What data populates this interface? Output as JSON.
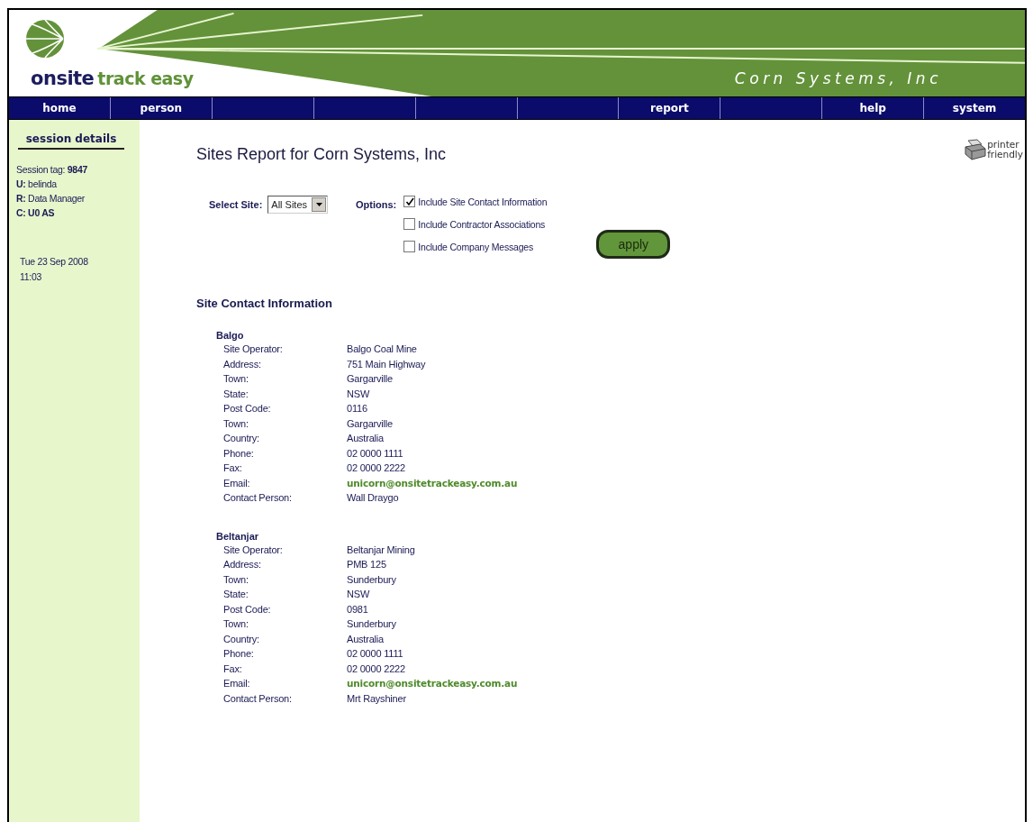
{
  "header": {
    "brand": "onsite",
    "tagline": "track easy",
    "company": "Corn Systems, Inc"
  },
  "nav": [
    {
      "kind": "tab",
      "label": "home"
    },
    {
      "kind": "tab",
      "label": "person"
    },
    {
      "kind": "blank"
    },
    {
      "kind": "blank"
    },
    {
      "kind": "blank"
    },
    {
      "kind": "blank"
    },
    {
      "kind": "tab",
      "label": "report"
    },
    {
      "kind": "blank"
    },
    {
      "kind": "tab",
      "label": "help"
    },
    {
      "kind": "tab",
      "label": "system"
    }
  ],
  "sidebar": {
    "title": "session details",
    "lines": [
      "Session tag: **9847**",
      "**U:** belinda",
      "**R:** Data Manager",
      "**C: U0 AS**"
    ],
    "date": "Tue 23 Sep 2008",
    "time": "11:03"
  },
  "report": {
    "title": "Sites Report for Corn Systems, Inc",
    "printer": [
      "printer",
      "friendly"
    ]
  },
  "filters": {
    "site_label": "Select Site:",
    "site_value": "All Sites",
    "options_label": "Options:",
    "options": [
      {
        "label": "Include Site Contact Information",
        "checked": true
      },
      {
        "label": "Include Contractor Associations",
        "checked": false
      },
      {
        "label": "Include Company Messages",
        "checked": false
      }
    ],
    "apply": "apply"
  },
  "section_title": "Site Contact Information",
  "sites": [
    {
      "name": "Balgo",
      "fields": [
        {
          "kind": "text",
          "label": "Site Operator:",
          "value": "Balgo Coal Mine"
        },
        {
          "kind": "text",
          "label": "Address:",
          "value": "751 Main Highway"
        },
        {
          "kind": "text",
          "label": "Town:",
          "value": "Gargarville"
        },
        {
          "kind": "text",
          "label": "State:",
          "value": "NSW"
        },
        {
          "kind": "text",
          "label": "Post Code:",
          "value": "0116"
        },
        {
          "kind": "text",
          "label": "Town:",
          "value": "Gargarville"
        },
        {
          "kind": "text",
          "label": "Country:",
          "value": "Australia"
        },
        {
          "kind": "text",
          "label": "Phone:",
          "value": "02 0000 1111"
        },
        {
          "kind": "text",
          "label": "Fax:",
          "value": "02 0000 2222"
        },
        {
          "kind": "email",
          "label": "Email:",
          "value": "unicorn@onsitetrackeasy.com.au"
        },
        {
          "kind": "text",
          "label": "Contact Person:",
          "value": "Wall Draygo"
        }
      ]
    },
    {
      "name": "Beltanjar",
      "fields": [
        {
          "kind": "text",
          "label": "Site Operator:",
          "value": "Beltanjar Mining"
        },
        {
          "kind": "text",
          "label": "Address:",
          "value": "PMB 125"
        },
        {
          "kind": "text",
          "label": "Town:",
          "value": "Sunderbury"
        },
        {
          "kind": "text",
          "label": "State:",
          "value": "NSW"
        },
        {
          "kind": "text",
          "label": "Post Code:",
          "value": "0981"
        },
        {
          "kind": "text",
          "label": "Town:",
          "value": "Sunderbury"
        },
        {
          "kind": "text",
          "label": "Country:",
          "value": "Australia"
        },
        {
          "kind": "text",
          "label": "Phone:",
          "value": "02 0000 1111"
        },
        {
          "kind": "text",
          "label": "Fax:",
          "value": "02 0000 2222"
        },
        {
          "kind": "email",
          "label": "Email:",
          "value": "unicorn@onsitetrackeasy.com.au"
        },
        {
          "kind": "text",
          "label": "Contact Person:",
          "value": "Mrt Rayshiner"
        }
      ]
    }
  ]
}
